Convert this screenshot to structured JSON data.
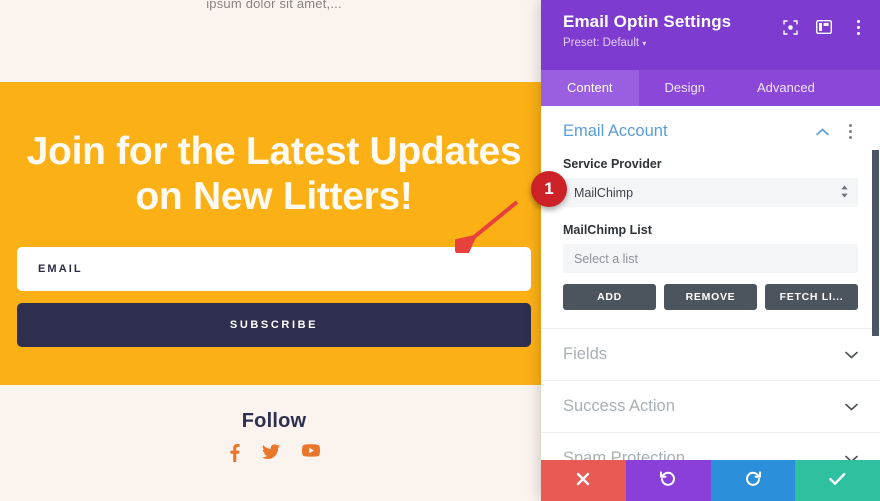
{
  "site": {
    "intro_text": "ipsum dolor sit amet,...",
    "optin": {
      "title_line1": "Join for the Latest Updates",
      "title_line2": "on New Litters!",
      "email_label": "EMAIL",
      "email_placeholder": "EMAIL",
      "subscribe_label": "SUBSCRIBE",
      "bg_color": "#fbb016",
      "button_color": "#2e2e4f"
    },
    "follow": {
      "title": "Follow",
      "icons": [
        {
          "name": "facebook-icon",
          "label": "Facebook"
        },
        {
          "name": "twitter-icon",
          "label": "Twitter"
        },
        {
          "name": "youtube-icon",
          "label": "YouTube"
        }
      ],
      "icon_color": "#e8762c"
    },
    "annotation": {
      "arrow_color": "#e8413c",
      "badge_number": "1"
    }
  },
  "modal": {
    "title": "Email Optin Settings",
    "preset": "Preset: Default",
    "preset_caret": "▾",
    "header_color": "#7e3bd0",
    "header_icons": [
      {
        "name": "focus-icon"
      },
      {
        "name": "layout-panel-icon"
      },
      {
        "name": "more-vertical-icon"
      }
    ],
    "tabs": [
      {
        "label": "Content",
        "active": true
      },
      {
        "label": "Design",
        "active": false
      },
      {
        "label": "Advanced",
        "active": false
      }
    ],
    "sections": {
      "email_account": {
        "title": "Email Account",
        "expanded": true,
        "chevron": "chevron-up-icon",
        "service_provider": {
          "label": "Service Provider",
          "value": "MailChimp"
        },
        "mailchimp_list": {
          "label": "MailChimp List",
          "value": "Select a list",
          "is_placeholder": true
        },
        "buttons": [
          {
            "label": "ADD",
            "name": "add-button"
          },
          {
            "label": "REMOVE",
            "name": "remove-button"
          },
          {
            "label": "FETCH LI...",
            "name": "fetch-lists-button"
          }
        ]
      },
      "collapsed": [
        {
          "label": "Fields",
          "name": "section-fields"
        },
        {
          "label": "Success Action",
          "name": "section-success-action"
        },
        {
          "label": "Spam Protection",
          "name": "section-spam-protection"
        }
      ]
    },
    "action_bar": [
      {
        "name": "cancel-button",
        "icon": "close-icon",
        "color": "#ea5a54"
      },
      {
        "name": "undo-button",
        "icon": "undo-icon",
        "color": "#8b3fd9"
      },
      {
        "name": "redo-button",
        "icon": "redo-icon",
        "color": "#2b90d9"
      },
      {
        "name": "save-button",
        "icon": "check-icon",
        "color": "#2fc0a0"
      }
    ]
  }
}
